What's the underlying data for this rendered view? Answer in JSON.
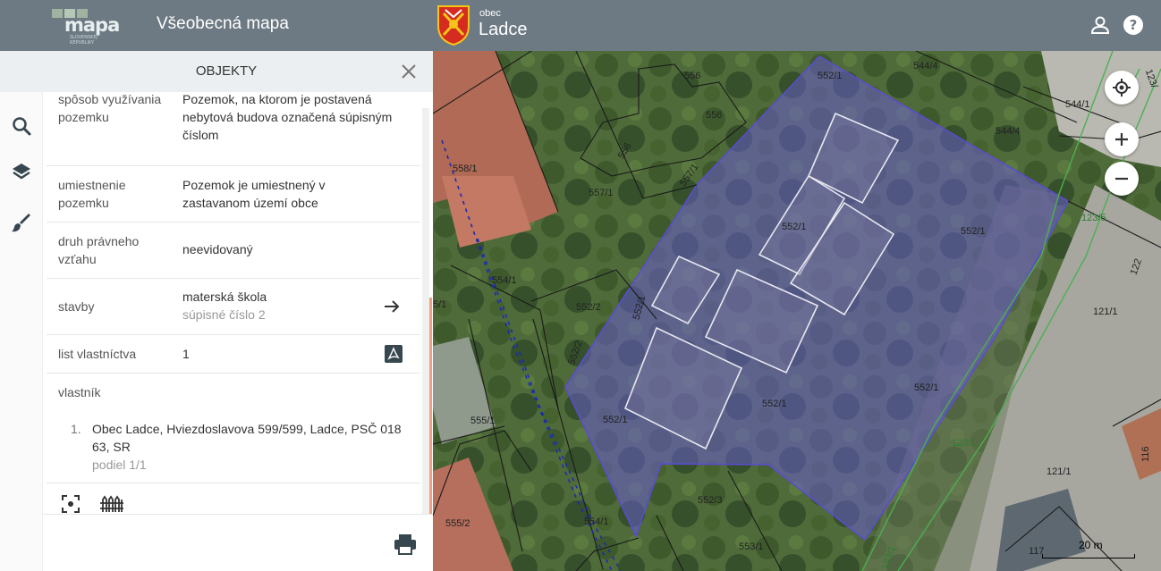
{
  "header": {
    "logo_text": "mapa",
    "logo_subtext": "SLOVENSKEJ REPUBLIKY",
    "app_title": "Všeobecná mapa",
    "obec_label": "obec",
    "obec_name": "Ladce",
    "user_icon": "user-icon",
    "help_icon": "help-icon"
  },
  "sidebar": {
    "icons": [
      "search-icon",
      "layers-icon",
      "brush-icon"
    ]
  },
  "panel": {
    "title": "OBJEKTY",
    "rows": [
      {
        "label": "spôsob využívania pozemku",
        "value": "Pozemok, na ktorom je postavená nebytová budova označená súpisným číslom"
      },
      {
        "label": "umiestnenie pozemku",
        "value": "Pozemok je umiestnený v zastavanom území obce"
      },
      {
        "label": "druh právneho vzťahu",
        "value": "neevidovaný"
      },
      {
        "label": "stavby",
        "value": "materská škola",
        "sub": "súpisné číslo 2"
      },
      {
        "label": "list vlastníctva",
        "value": "1"
      },
      {
        "label": "vlastník"
      }
    ],
    "owner": {
      "index": "1.",
      "name": "Obec Ladce, Hviezdoslavova 599/599, Ladce, PSČ 018 63, SR",
      "share": "podiel 1/1"
    },
    "bottom_icons": [
      "focus-icon",
      "fence-icon"
    ],
    "print_icon": "print-icon"
  },
  "map": {
    "parcels": [
      "552/1",
      "552/1",
      "552/1",
      "552/1",
      "552/1",
      "552/1",
      "552/1",
      "552/2",
      "552/2",
      "552/3",
      "553/1",
      "554/1",
      "554/1",
      "555/1",
      "555/2",
      "556",
      "556",
      "556",
      "557/1",
      "557/1",
      "558/1",
      "544/4",
      "544/4",
      "544/1",
      "117",
      "116",
      "121/1",
      "121/1",
      "123/1",
      "123/1",
      "123/5",
      "122",
      "21",
      "123/",
      "5/1"
    ],
    "scale_label": "20 m",
    "controls": [
      "locate-icon",
      "zoom-in-icon",
      "zoom-out-icon"
    ],
    "colors": {
      "selection": "#6b5cd9",
      "parcel_lines": "#222222",
      "road_lines": "#4caf50"
    }
  }
}
